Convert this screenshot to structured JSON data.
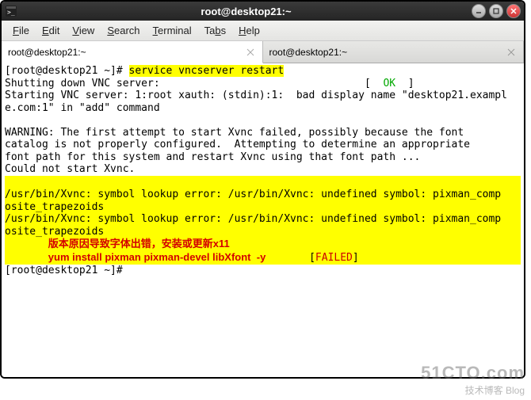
{
  "window": {
    "title": "root@desktop21:~"
  },
  "menu": {
    "file": "File",
    "edit": "Edit",
    "view": "View",
    "search": "Search",
    "terminal": "Terminal",
    "tabs": "Tabs",
    "help": "Help"
  },
  "tabs": [
    {
      "label": "root@desktop21:~"
    },
    {
      "label": "root@desktop21:~"
    }
  ],
  "term": {
    "prompt1": "[root@desktop21 ~]# ",
    "cmd1": "service vncserver restart",
    "line_shutdown": "Shutting down VNC server:                                 [  ",
    "ok": "OK",
    "bracket_end": "  ]",
    "line_start": "Starting VNC server: 1:root xauth: (stdin):1:  bad display name \"desktop21.exampl",
    "line_start2": "e.com:1\" in \"add\" command",
    "warn1": "WARNING: The first attempt to start Xvnc failed, possibly because the font",
    "warn2": "catalog is not properly configured.  Attempting to determine an appropriate",
    "warn3": "font path for this system and restart Xvnc using that font path ...",
    "warn4": "Could not start Xvnc.",
    "err1": "/usr/bin/Xvnc: symbol lookup error: /usr/bin/Xvnc: undefined symbol: pixman_comp",
    "err2": "osite_trapezoids",
    "err3": "/usr/bin/Xvnc: symbol lookup error: /usr/bin/Xvnc: undefined symbol: pixman_comp",
    "err4": "osite_trapezoids",
    "anno1": "版本原因导致字体出错，安装或更新x11",
    "anno2": "yum install pixman pixman-devel libXfont  -y",
    "failed_pre": "                                                           [",
    "failed": "FAILED",
    "failed_post": "]",
    "prompt2": "[root@desktop21 ~]# "
  },
  "watermark": {
    "big": "51CTO.com",
    "small": "技术博客   Blog"
  }
}
